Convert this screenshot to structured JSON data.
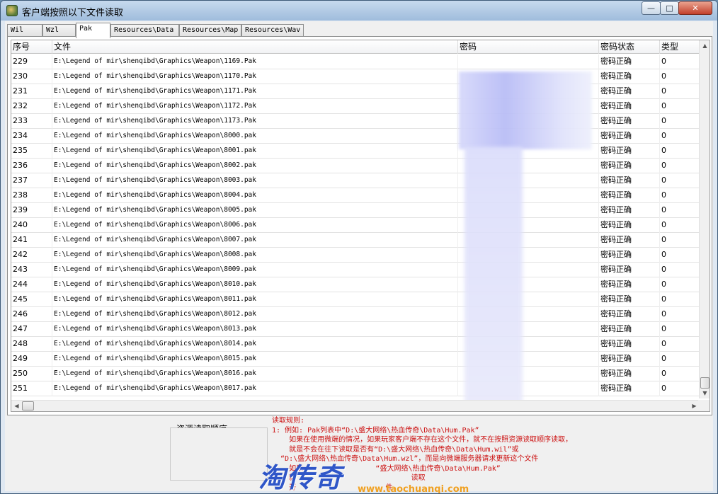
{
  "window": {
    "title": "客户端按照以下文件读取",
    "min_label": "—",
    "max_label": "□",
    "close_label": "✕"
  },
  "tabs": [
    "Wil",
    "Wzl",
    "Pak",
    "Resources\\Data",
    "Resources\\Map",
    "Resources\\Wav"
  ],
  "active_tab": "Pak",
  "columns": [
    "序号",
    "文件",
    "密码",
    "密码状态",
    "类型"
  ],
  "rows": [
    {
      "id": "229",
      "file": "E:\\Legend of mir\\shenqibd\\Graphics\\Weapon\\1169.Pak",
      "status": "密码正确",
      "type": "0"
    },
    {
      "id": "230",
      "file": "E:\\Legend of mir\\shenqibd\\Graphics\\Weapon\\1170.Pak",
      "status": "密码正确",
      "type": "0"
    },
    {
      "id": "231",
      "file": "E:\\Legend of mir\\shenqibd\\Graphics\\Weapon\\1171.Pak",
      "status": "密码正确",
      "type": "0"
    },
    {
      "id": "232",
      "file": "E:\\Legend of mir\\shenqibd\\Graphics\\Weapon\\1172.Pak",
      "status": "密码正确",
      "type": "0"
    },
    {
      "id": "233",
      "file": "E:\\Legend of mir\\shenqibd\\Graphics\\Weapon\\1173.Pak",
      "status": "密码正确",
      "type": "0"
    },
    {
      "id": "234",
      "file": "E:\\Legend of mir\\shenqibd\\Graphics\\Weapon\\8000.pak",
      "status": "密码正确",
      "type": "0"
    },
    {
      "id": "235",
      "file": "E:\\Legend of mir\\shenqibd\\Graphics\\Weapon\\8001.pak",
      "status": "密码正确",
      "type": "0"
    },
    {
      "id": "236",
      "file": "E:\\Legend of mir\\shenqibd\\Graphics\\Weapon\\8002.pak",
      "status": "密码正确",
      "type": "0"
    },
    {
      "id": "237",
      "file": "E:\\Legend of mir\\shenqibd\\Graphics\\Weapon\\8003.pak",
      "status": "密码正确",
      "type": "0"
    },
    {
      "id": "238",
      "file": "E:\\Legend of mir\\shenqibd\\Graphics\\Weapon\\8004.pak",
      "status": "密码正确",
      "type": "0"
    },
    {
      "id": "239",
      "file": "E:\\Legend of mir\\shenqibd\\Graphics\\Weapon\\8005.pak",
      "status": "密码正确",
      "type": "0"
    },
    {
      "id": "240",
      "file": "E:\\Legend of mir\\shenqibd\\Graphics\\Weapon\\8006.pak",
      "status": "密码正确",
      "type": "0"
    },
    {
      "id": "241",
      "file": "E:\\Legend of mir\\shenqibd\\Graphics\\Weapon\\8007.pak",
      "status": "密码正确",
      "type": "0"
    },
    {
      "id": "242",
      "file": "E:\\Legend of mir\\shenqibd\\Graphics\\Weapon\\8008.pak",
      "status": "密码正确",
      "type": "0"
    },
    {
      "id": "243",
      "file": "E:\\Legend of mir\\shenqibd\\Graphics\\Weapon\\8009.pak",
      "status": "密码正确",
      "type": "0"
    },
    {
      "id": "244",
      "file": "E:\\Legend of mir\\shenqibd\\Graphics\\Weapon\\8010.pak",
      "status": "密码正确",
      "type": "0"
    },
    {
      "id": "245",
      "file": "E:\\Legend of mir\\shenqibd\\Graphics\\Weapon\\8011.pak",
      "status": "密码正确",
      "type": "0"
    },
    {
      "id": "246",
      "file": "E:\\Legend of mir\\shenqibd\\Graphics\\Weapon\\8012.pak",
      "status": "密码正确",
      "type": "0"
    },
    {
      "id": "247",
      "file": "E:\\Legend of mir\\shenqibd\\Graphics\\Weapon\\8013.pak",
      "status": "密码正确",
      "type": "0"
    },
    {
      "id": "248",
      "file": "E:\\Legend of mir\\shenqibd\\Graphics\\Weapon\\8014.pak",
      "status": "密码正确",
      "type": "0"
    },
    {
      "id": "249",
      "file": "E:\\Legend of mir\\shenqibd\\Graphics\\Weapon\\8015.pak",
      "status": "密码正确",
      "type": "0"
    },
    {
      "id": "250",
      "file": "E:\\Legend of mir\\shenqibd\\Graphics\\Weapon\\8016.pak",
      "status": "密码正确",
      "type": "0"
    },
    {
      "id": "251",
      "file": "E:\\Legend of mir\\shenqibd\\Graphics\\Weapon\\8017.pak",
      "status": "密码正确",
      "type": "0"
    }
  ],
  "order_label": "资源读取顺序",
  "rules": [
    "读取规则:",
    "1: 例如: Pak列表中“D:\\盛大网络\\热血传奇\\Data\\Hum.Pak”",
    "    如果在使用微端的情况，如果玩家客户端不存在这个文件，就不在按照资源读取顺序读取，",
    "    就是不会在往下读取是否有“D:\\盛大网络\\热血传奇\\Data\\Hum.wil”或",
    "  “D:\\盛大网络\\热血传奇\\Data\\Hum.wzl”，而是向微端服务器请求更新这个文件",
    "    如果                 “盛大网络\\热血传奇\\Data\\Hum.Pak”",
    "    就                           读取",
    "    开                     件"
  ],
  "watermark": {
    "text": "淘传奇",
    "url": "www.taochuanqi.com"
  }
}
